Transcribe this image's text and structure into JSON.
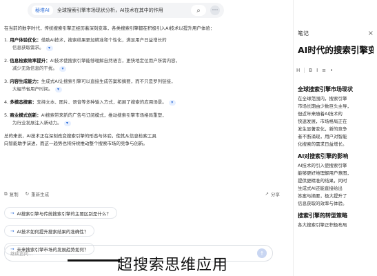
{
  "search": {
    "query": "全球搜索引擎市场现状分析，AI技术在其中的作用",
    "brand": "秘塔AI"
  },
  "answer": {
    "intro": "在当前的数字时代，传统搜索引擎正经历着深刻变革，各类搜索引擎都在积极引入AI技术以提升用户体验：",
    "items": [
      {
        "num": "1.",
        "head": "用户体验优化：",
        "body": "借助AI技术，搜索结果更加精准和个性化，满足用户日益增长的",
        "line2": "信息获取需求。"
      },
      {
        "num": "2.",
        "head": "信息检索效率提升：",
        "body": "AI技术使搜索引擎能够理解自然语言，更快地定位用户所需内容，",
        "line2": "减少无效信息的干扰。"
      },
      {
        "num": "3.",
        "head": "内容生成能力：",
        "body": "生成式AI让搜索引擎可以直接生成答案和摘要，而不只是罗列链接，",
        "line2": "大幅节省用户时间。"
      },
      {
        "num": "4.",
        "head": "多模态搜索：",
        "body": "支持文本、图片、语音等多种输入方式，拓展了搜索的应用场景。",
        "line2": ""
      },
      {
        "num": "5.",
        "head": "商业模式创新：",
        "body": "AI搜索带来新的广告与订阅模式，推动搜索引擎市场格局重塑，",
        "line2": "为行业发展注入新动力。"
      }
    ],
    "summary": [
      "总的来说，AI技术正在深刻改变搜索引擎的形态与体验，使其从信息检索工具",
      "向智能助手演进，而这一趋势也将持续推动整个搜索市场的竞争与创新。"
    ]
  },
  "actions": {
    "copy": "复制",
    "regen": "重新生成",
    "share": "分享"
  },
  "suggestions": [
    "AI搜索引擎与传统搜索引擎的主要区别是什么？",
    "AI技术如何提升搜索结果的准确性？",
    "未来搜索引擎市场的发展趋势如何？"
  ],
  "input": {
    "placeholder": "继续追问…"
  },
  "notes": {
    "label": "笔记",
    "doc_title": "AI时代的搜索引擎变革…",
    "toolbar": [
      "H",
      "B",
      "I",
      "≡",
      "•"
    ],
    "sections": [
      {
        "heading": "全球搜索引擎市场现状",
        "lines": [
          "在全球范围内，搜索引擎",
          "市场长期由少数巨头主导，",
          "但近年来随着AI技术的",
          "快速发展，市场格局正在",
          "发生显著变化，新的竞争",
          "者不断涌现，用户对智能",
          "化搜索的需求日益增长。"
        ]
      },
      {
        "heading": "AI对搜索引擎的影响",
        "lines": [
          "AI技术的引入使搜索引擎",
          "能够更好地理解用户意图，",
          "提供更精准的结果，同时",
          "生成式AI还能直接给出",
          "答案与摘要，极大提升了",
          "信息获取的效率与体验。"
        ]
      },
      {
        "heading": "搜索引擎的转型策略",
        "lines": [
          "各大搜索引擎正积极布局"
        ]
      }
    ]
  },
  "caption": "超搜索思维应用"
}
